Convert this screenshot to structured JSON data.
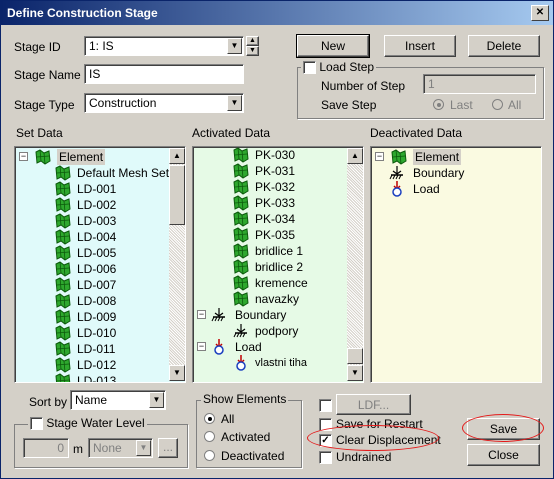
{
  "window": {
    "title": "Define Construction Stage",
    "close_glyph": "✕"
  },
  "stage": {
    "id_label": "Stage ID",
    "id_value": "1: IS",
    "name_label": "Stage Name",
    "name_value": "IS",
    "type_label": "Stage Type",
    "type_value": "Construction"
  },
  "buttons": {
    "new": "New",
    "insert": "Insert",
    "delete": "Delete",
    "ldf": "LDF...",
    "save": "Save",
    "close": "Close"
  },
  "load_step": {
    "title": "Load Step",
    "number_label": "Number of Step",
    "number_value": "1",
    "save_step_label": "Save Step",
    "last": "Last",
    "all": "All"
  },
  "set_data": {
    "header": "Set Data",
    "root": "Element",
    "items": [
      "Default Mesh Set",
      "LD-001",
      "LD-002",
      "LD-003",
      "LD-004",
      "LD-005",
      "LD-006",
      "LD-007",
      "LD-008",
      "LD-009",
      "LD-010",
      "LD-011",
      "LD-012",
      "LD-013"
    ]
  },
  "activated_data": {
    "header": "Activated Data",
    "elements": [
      "PK-030",
      "PK-031",
      "PK-032",
      "PK-033",
      "PK-034",
      "PK-035",
      "bridlice 1",
      "bridlice 2",
      "kremence",
      "navazky"
    ],
    "boundary": "Boundary",
    "boundary_child": "podpory",
    "load": "Load",
    "load_child": "vlastni tiha"
  },
  "deactivated_data": {
    "header": "Deactivated Data",
    "items": [
      "Element",
      "Boundary",
      "Load"
    ]
  },
  "sort": {
    "label": "Sort by",
    "value": "Name"
  },
  "water": {
    "label": "Stage Water Level",
    "value": "0",
    "unit": "m",
    "combo": "None",
    "browse": "..."
  },
  "show_elements": {
    "title": "Show Elements",
    "all": "All",
    "activated": "Activated",
    "deactivated": "Deactivated"
  },
  "options": {
    "save_restart": "Save for Restart",
    "clear_disp": "Clear Displacement",
    "undrained": "Undrained"
  },
  "colors": {
    "set_bg": "#e0fafa",
    "act_bg": "#e6fae6",
    "deact_bg": "#fafae1",
    "highlight": "#e41b1b",
    "mesh_green": "#2ea82e"
  }
}
